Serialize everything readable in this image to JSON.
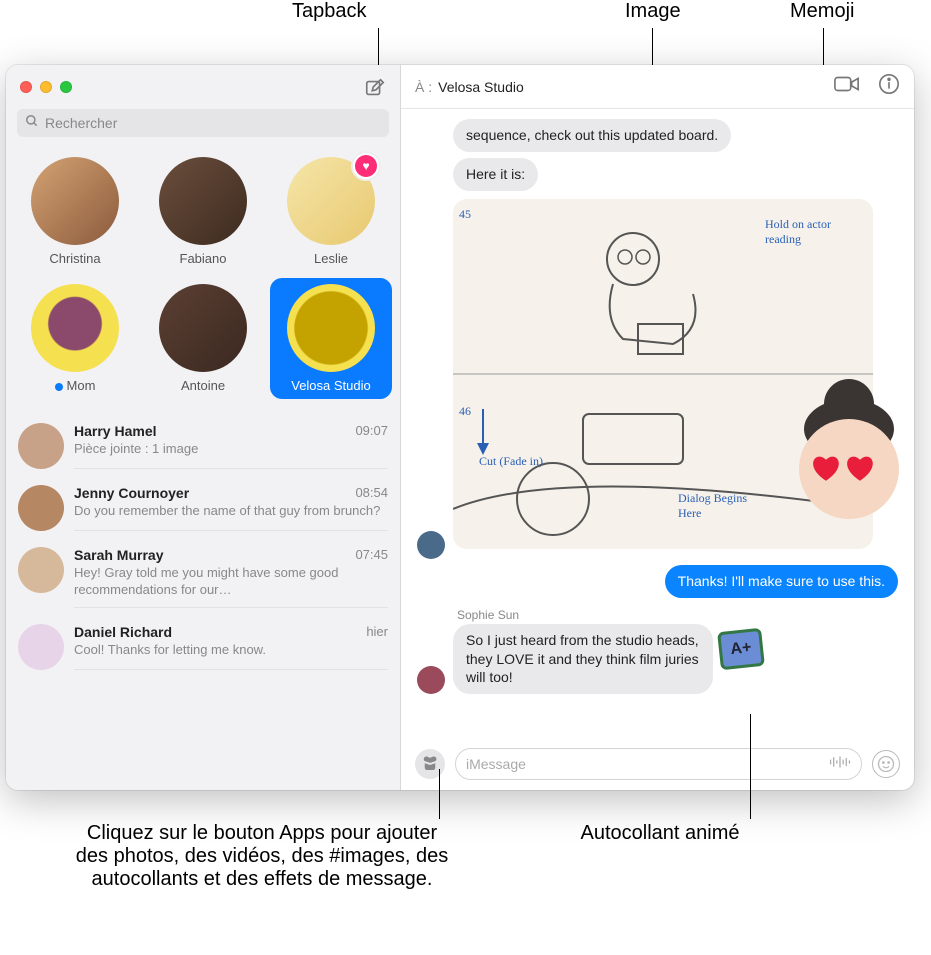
{
  "callouts": {
    "tapback": "Tapback",
    "image": "Image",
    "memoji": "Memoji",
    "apps": "Cliquez sur le bouton Apps pour ajouter des photos, des vidéos, des #images, des autocollants et des effets de message.",
    "sticker": "Autocollant animé"
  },
  "search": {
    "placeholder": "Rechercher"
  },
  "pinned": [
    {
      "name": "Christina"
    },
    {
      "name": "Fabiano"
    },
    {
      "name": "Leslie",
      "tapback": "heart"
    },
    {
      "name": "Mom",
      "unread": true
    },
    {
      "name": "Antoine"
    },
    {
      "name": "Velosa Studio",
      "selected": true
    }
  ],
  "conversations": [
    {
      "name": "Harry Hamel",
      "time": "09:07",
      "preview": "Pièce jointe : 1 image"
    },
    {
      "name": "Jenny Cournoyer",
      "time": "08:54",
      "preview": "Do you remember the name of that guy from brunch?"
    },
    {
      "name": "Sarah Murray",
      "time": "07:45",
      "preview": "Hey! Gray told me you might have some good recommendations for our…"
    },
    {
      "name": "Daniel Richard",
      "time": "hier",
      "preview": "Cool! Thanks for letting me know."
    }
  ],
  "header": {
    "to_label": "À :",
    "to_name": "Velosa Studio"
  },
  "messages": {
    "m1": "sequence, check out this updated board.",
    "m2": "Here it is:",
    "storyboard_notes": {
      "n1": "Hold on actor reading",
      "n2": "Cut (Fade in)",
      "n3": "Dialog Begins Here",
      "n4": "45",
      "n5": "46"
    },
    "out1": "Thanks! I'll make sure to use this.",
    "sender2": "Sophie Sun",
    "m3": "So I just heard from the studio heads, they LOVE it and they think film juries will too!",
    "aplus": "A+"
  },
  "composer": {
    "placeholder": "iMessage"
  }
}
